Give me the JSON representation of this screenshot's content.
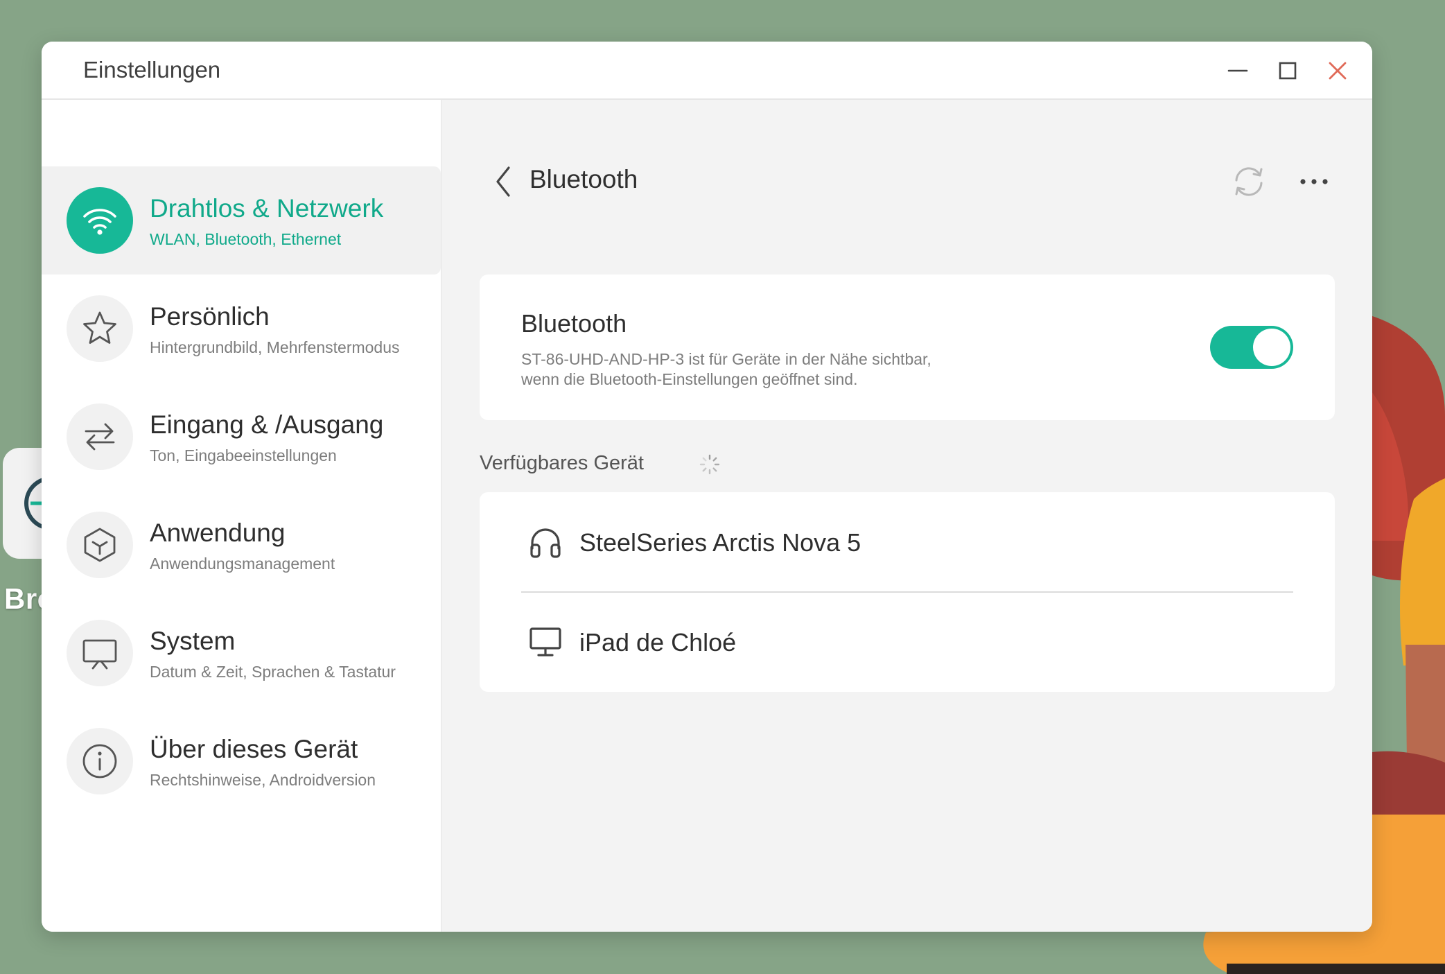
{
  "colors": {
    "desktop_background": "#86a487",
    "accent": "#17b897",
    "active_text": "#10a98a",
    "close_red": "#e06a58"
  },
  "desktop": {
    "browser_label": "Bro"
  },
  "window": {
    "title": "Einstellungen",
    "controls": [
      "minimize-icon",
      "maximize-icon",
      "close-icon"
    ]
  },
  "sidebar": {
    "items": [
      {
        "title": "Drahtlos & Netzwerk",
        "subtitle": "WLAN, Bluetooth, Ethernet",
        "icon": "wifi-icon",
        "active": true
      },
      {
        "title": "Persönlich",
        "subtitle": "Hintergrundbild, Mehrfenstermodus",
        "icon": "star-icon",
        "active": false
      },
      {
        "title": "Eingang & /Ausgang",
        "subtitle": "Ton, Eingabeeinstellungen",
        "icon": "swap-arrows-icon",
        "active": false
      },
      {
        "title": "Anwendung",
        "subtitle": "Anwendungsmanagement",
        "icon": "cube-icon",
        "active": false
      },
      {
        "title": "System",
        "subtitle": "Datum & Zeit, Sprachen & Tastatur",
        "icon": "display-icon",
        "active": false
      },
      {
        "title": "Über dieses Gerät",
        "subtitle": "Rechtshinweise, Androidversion",
        "icon": "info-icon",
        "active": false
      }
    ]
  },
  "content": {
    "page_title": "Bluetooth",
    "bluetooth_card": {
      "title": "Bluetooth",
      "description_line1": "ST-86-UHD-AND-HP-3 ist für Geräte in der Nähe sichtbar,",
      "description_line2": "wenn die Bluetooth-Einstellungen geöffnet sind.",
      "enabled": true
    },
    "available_label": "Verfügbares Gerät",
    "devices": [
      {
        "name": "SteelSeries Arctis Nova 5",
        "icon": "headphones-icon"
      },
      {
        "name": "iPad de Chloé",
        "icon": "monitor-icon"
      }
    ]
  }
}
